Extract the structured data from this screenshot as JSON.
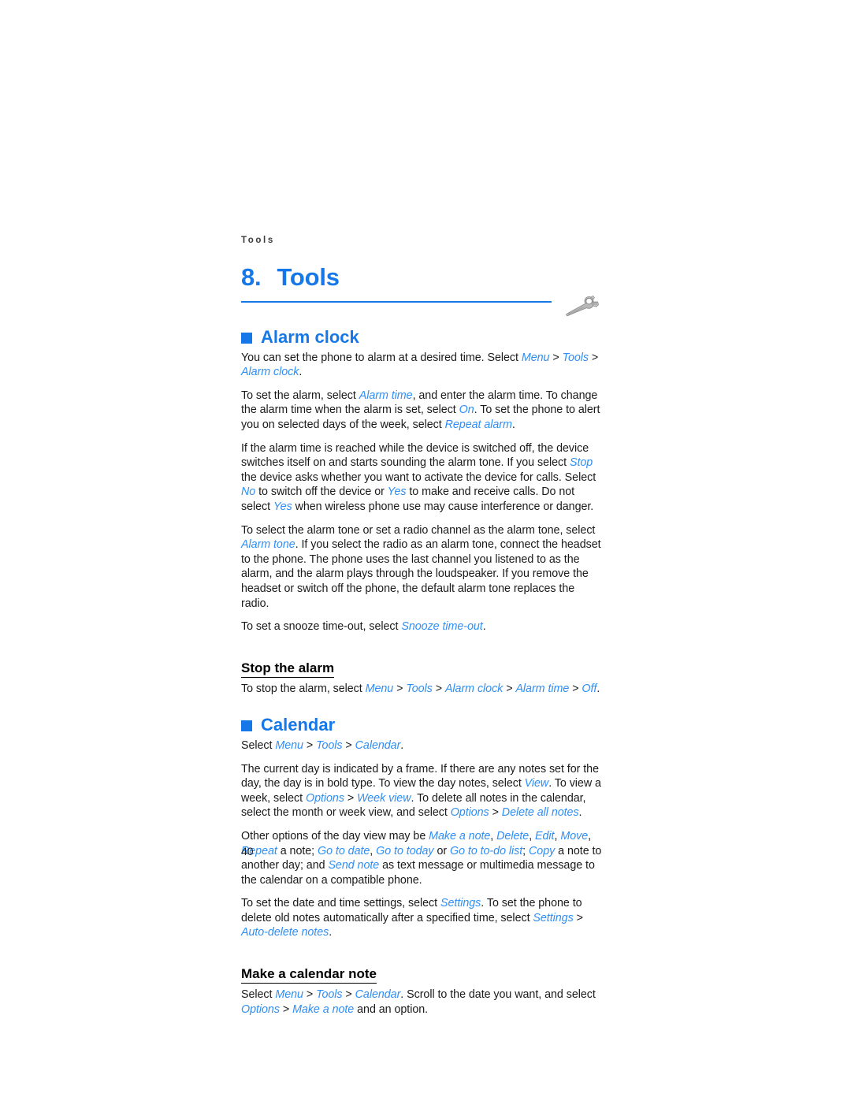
{
  "document": {
    "running_header": "Tools",
    "page_number": "40",
    "chapter_number": "8.",
    "chapter_title": "Tools",
    "chapter_icon": "wrench-icon",
    "colors": {
      "heading_blue": "#1678e8",
      "reference_blue": "#2e8ef5",
      "body_text": "#1a1a1a",
      "page_background": "#ffffff"
    }
  },
  "sections": [
    {
      "id": "alarm-clock",
      "heading": "Alarm clock",
      "paragraphs": {
        "p1": {
          "t1": "You can set the phone to alarm at a desired time. Select ",
          "r1": "Menu",
          "s1": " > ",
          "r2": "Tools",
          "s2": " > ",
          "r3": "Alarm clock",
          "t2": "."
        },
        "p2": {
          "t1": "To set the alarm, select ",
          "r1": "Alarm time",
          "t2": ", and enter the alarm time. To change the alarm time when the alarm is set, select ",
          "r2": "On",
          "t3": ". To set the phone to alert you on selected days of the week, select ",
          "r3": "Repeat alarm",
          "t4": "."
        },
        "p3": {
          "t1": "If the alarm time is reached while the device is switched off, the device switches itself on and starts sounding the alarm tone. If you select ",
          "r1": "Stop",
          "t2": " the device asks whether you want to activate the device for calls. Select ",
          "r2": "No",
          "t3": " to switch off the device or ",
          "r3": "Yes",
          "t4": " to make and receive calls. Do not select ",
          "r4": "Yes",
          "t5": " when wireless phone use may cause interference or danger."
        },
        "p4": {
          "t1": "To select the alarm tone or set a radio channel as the alarm tone, select ",
          "r1": "Alarm tone",
          "t2": ". If you select the radio as an alarm tone, connect the headset to the phone. The phone uses the last channel you listened to as the alarm, and the alarm plays through the loudspeaker. If you remove the headset or switch off the phone, the default alarm tone replaces the radio."
        },
        "p5": {
          "t1": "To set a snooze time-out, select ",
          "r1": "Snooze time-out",
          "t2": "."
        }
      },
      "subsection": {
        "heading": "Stop the alarm",
        "paragraph": {
          "t1": "To stop the alarm, select ",
          "r1": "Menu",
          "s1": " > ",
          "r2": "Tools",
          "s2": " > ",
          "r3": "Alarm clock",
          "s3": " > ",
          "r4": "Alarm time",
          "s4": " > ",
          "r5": "Off",
          "t2": "."
        }
      }
    },
    {
      "id": "calendar",
      "heading": "Calendar",
      "paragraphs": {
        "p1": {
          "t1": "Select ",
          "r1": "Menu",
          "s1": " > ",
          "r2": "Tools",
          "s2": " > ",
          "r3": "Calendar",
          "t2": "."
        },
        "p2": {
          "t1": "The current day is indicated by a frame. If there are any notes set for the day, the day is in bold type. To view the day notes, select ",
          "r1": "View",
          "t2": ". To view a week, select ",
          "r2": "Options",
          "s1": " > ",
          "r3": "Week view",
          "t3": ". To delete all notes in the calendar, select the month or week view, and select ",
          "r4": "Options",
          "s2": " > ",
          "r5": "Delete all notes",
          "t4": "."
        },
        "p3": {
          "t1": "Other options of the day view may be ",
          "r1": "Make a note",
          "t2": ", ",
          "r2": "Delete",
          "t3": ", ",
          "r3": "Edit",
          "t4": ", ",
          "r4": "Move",
          "t5": ", ",
          "r5": "Repeat",
          "t6": " a note; ",
          "r6": "Go to date",
          "t7": ", ",
          "r7": "Go to today",
          "t8": " or ",
          "r8": "Go to to-do list",
          "t9": "; ",
          "r9": "Copy",
          "t10": " a note to another day; and ",
          "r10": "Send note",
          "t11": " as text message or multimedia message to the calendar on a compatible phone."
        },
        "p4": {
          "t1": "To set the date and time settings, select ",
          "r1": "Settings",
          "t2": ". To set the phone to delete old notes automatically after a specified time, select ",
          "r2": "Settings",
          "s1": " > ",
          "r3": "Auto-delete notes",
          "t3": "."
        }
      },
      "subsection": {
        "heading": "Make a calendar note",
        "paragraph": {
          "t1": "Select ",
          "r1": "Menu",
          "s1": " > ",
          "r2": "Tools",
          "s2": " > ",
          "r3": "Calendar",
          "t2": ". Scroll to the date you want, and select ",
          "r4": "Options",
          "s3": " > ",
          "r5": "Make a note",
          "t3": " and an option."
        }
      }
    }
  ]
}
